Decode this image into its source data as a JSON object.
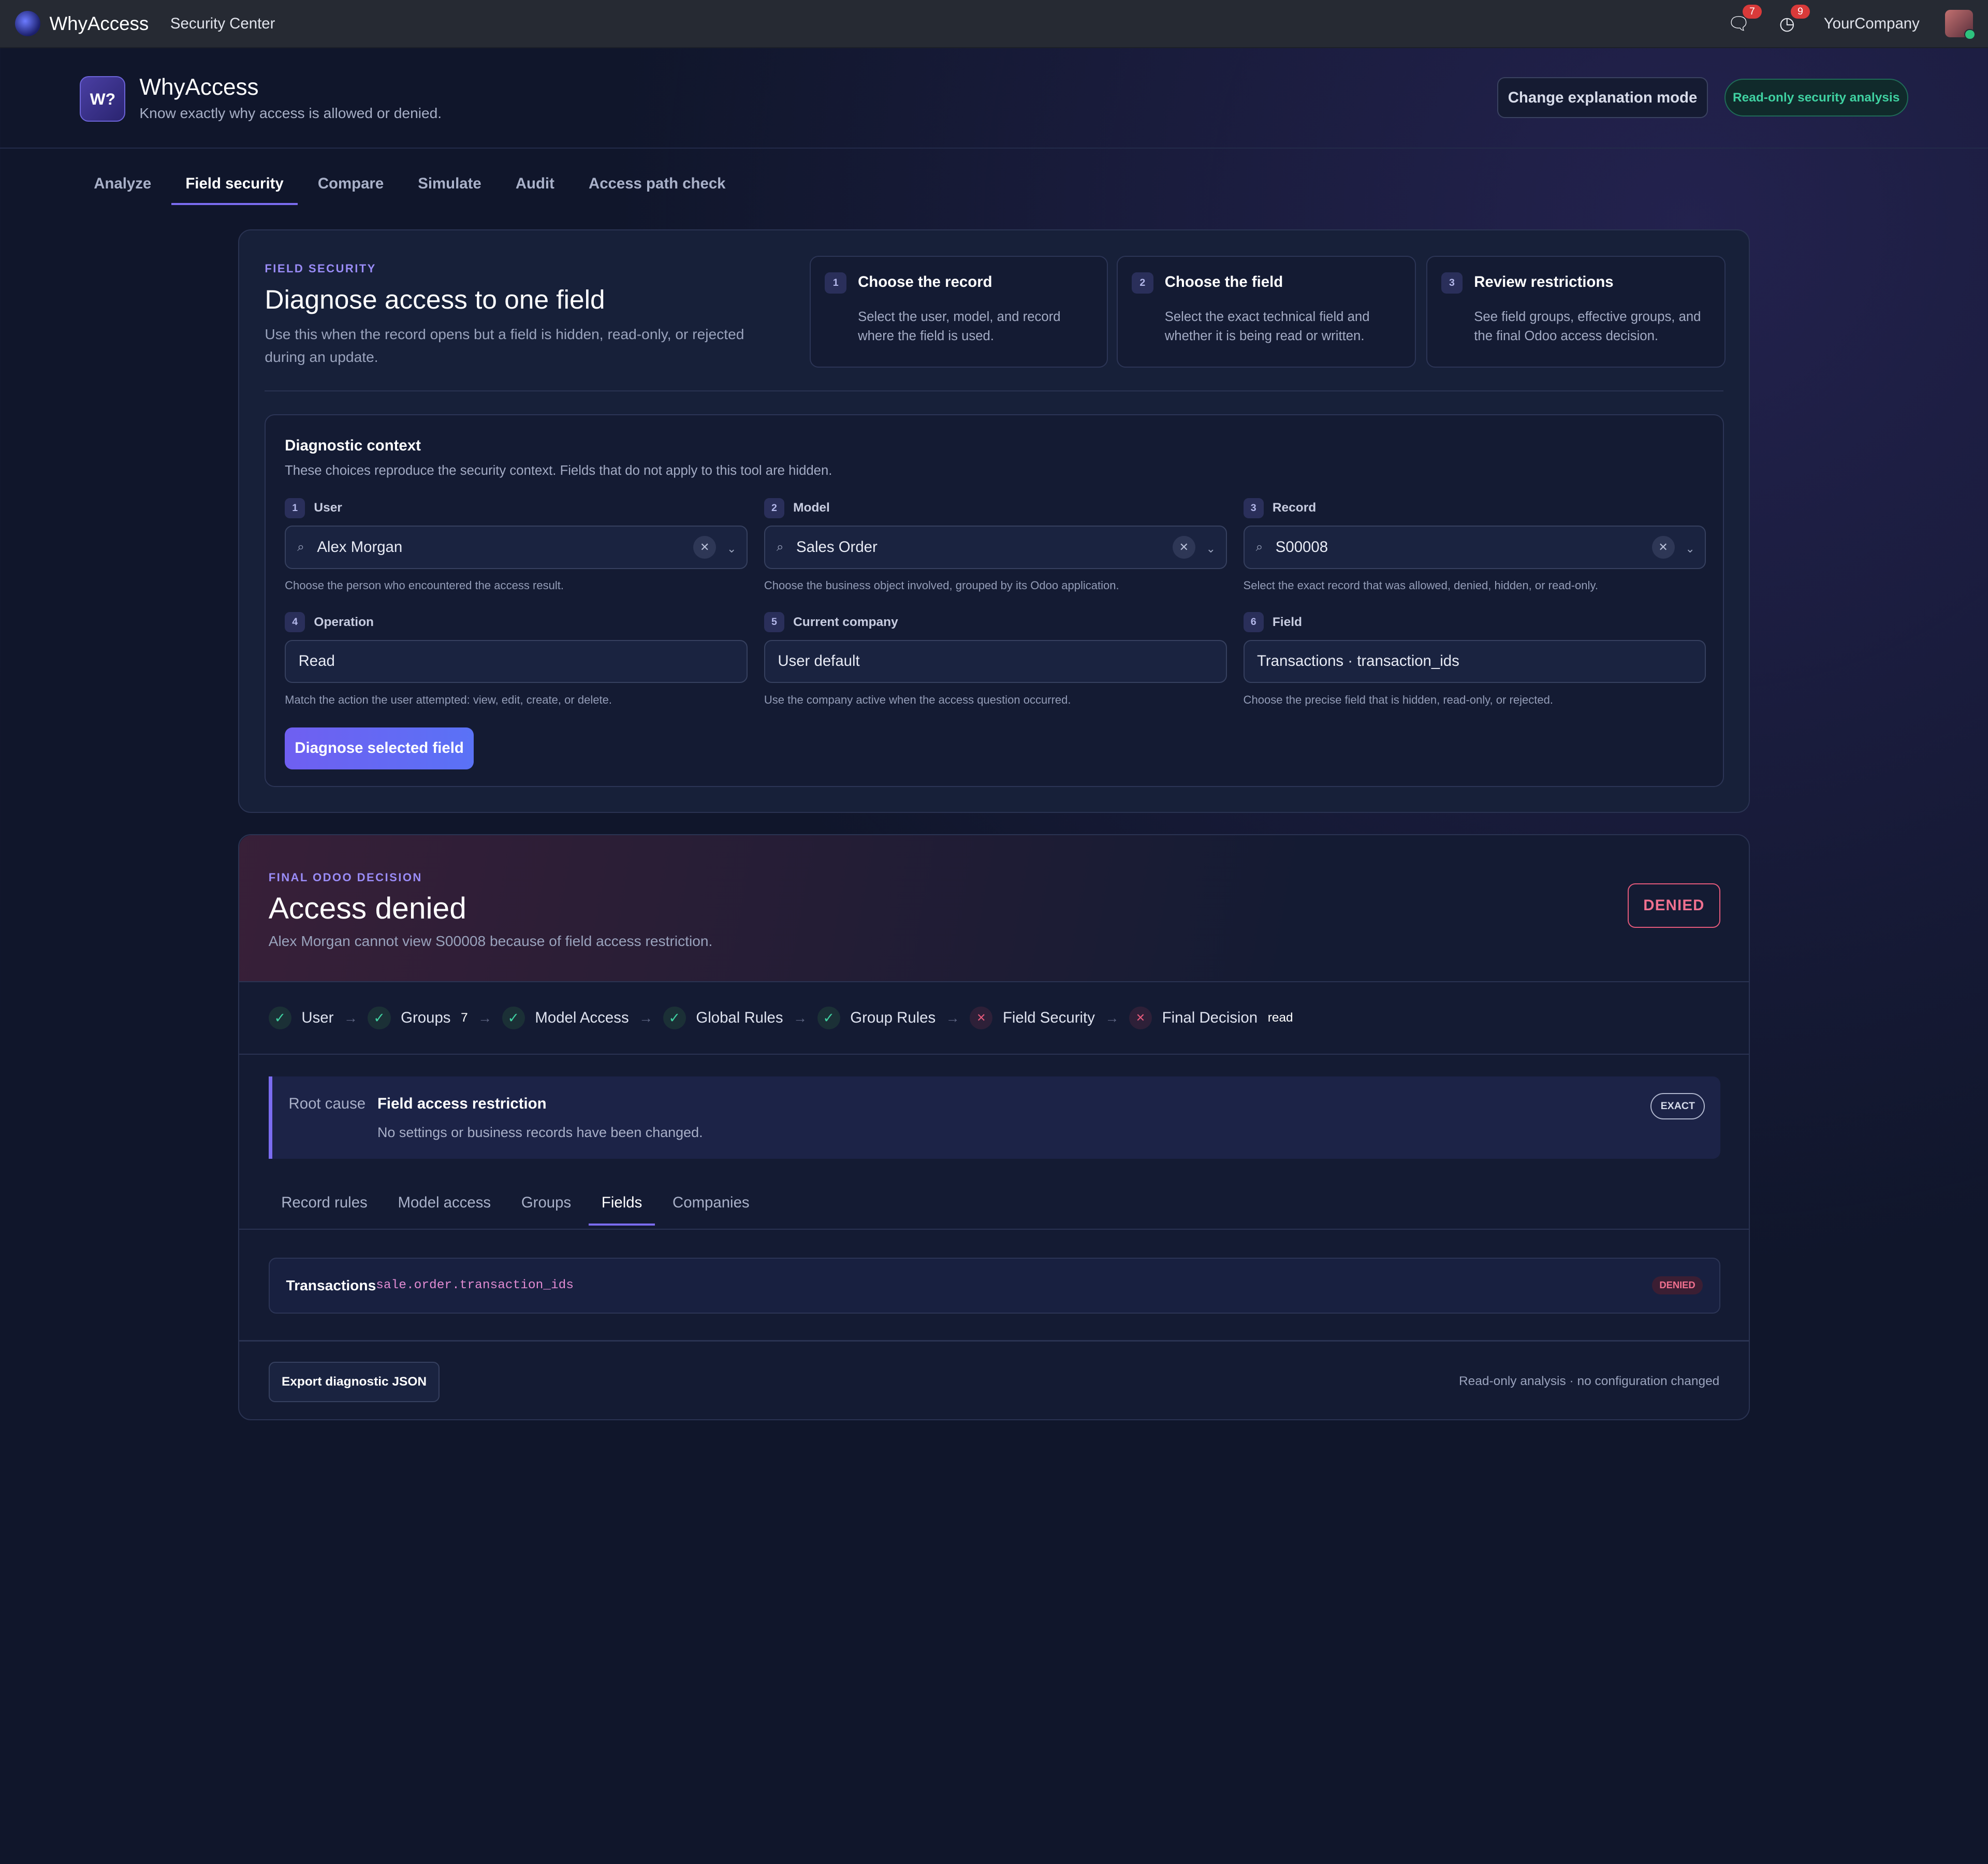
{
  "topbar": {
    "brand": "WhyAccess",
    "menu": "Security Center",
    "chat_badge": "7",
    "activity_badge": "9",
    "company": "YourCompany"
  },
  "header": {
    "logo_text": "W?",
    "title": "WhyAccess",
    "subtitle": "Know exactly why access is allowed or denied.",
    "mode_button": "Change explanation mode",
    "readonly_badge": "Read-only security analysis"
  },
  "tabs": [
    "Analyze",
    "Field security",
    "Compare",
    "Simulate",
    "Audit",
    "Access path check"
  ],
  "active_tab": "Field security",
  "field_security": {
    "eyebrow": "FIELD SECURITY",
    "title": "Diagnose access to one field",
    "description": "Use this when the record opens but a field is hidden, read-only, or rejected during an update.",
    "steps": [
      {
        "num": "1",
        "title": "Choose the record",
        "desc": "Select the user, model, and record where the field is used."
      },
      {
        "num": "2",
        "title": "Choose the field",
        "desc": "Select the exact technical field and whether it is being read or written."
      },
      {
        "num": "3",
        "title": "Review restrictions",
        "desc": "See field groups, effective groups, and the final Odoo access decision."
      }
    ]
  },
  "context": {
    "title": "Diagnostic context",
    "subtitle": "These choices reproduce the security context. Fields that do not apply to this tool are hidden.",
    "fields": [
      {
        "num": "1",
        "label": "User",
        "value": "Alex Morgan",
        "help": "Choose the person who encountered the access result."
      },
      {
        "num": "2",
        "label": "Model",
        "value": "Sales Order",
        "help": "Choose the business object involved, grouped by its Odoo application."
      },
      {
        "num": "3",
        "label": "Record",
        "value": "S00008",
        "help": "Select the exact record that was allowed, denied, hidden, or read-only."
      },
      {
        "num": "4",
        "label": "Operation",
        "value": "Read",
        "help": "Match the action the user attempted: view, edit, create, or delete."
      },
      {
        "num": "5",
        "label": "Current company",
        "value": "User default",
        "help": "Use the company active when the access question occurred."
      },
      {
        "num": "6",
        "label": "Field",
        "value": "Transactions · transaction_ids",
        "help": "Choose the precise field that is hidden, read-only, or rejected."
      }
    ],
    "diagnose_button": "Diagnose selected field"
  },
  "decision": {
    "eyebrow": "FINAL ODOO DECISION",
    "title": "Access denied",
    "summary": "Alex Morgan cannot view S00008 because of field access restriction.",
    "badge": "DENIED",
    "chain": [
      {
        "label": "User",
        "status": "ok"
      },
      {
        "label": "Groups",
        "status": "ok",
        "extra": "7"
      },
      {
        "label": "Model Access",
        "status": "ok"
      },
      {
        "label": "Global Rules",
        "status": "ok"
      },
      {
        "label": "Group Rules",
        "status": "ok"
      },
      {
        "label": "Field Security",
        "status": "denied"
      },
      {
        "label": "Final Decision",
        "status": "denied",
        "extra": "read"
      }
    ],
    "root_cause": {
      "label": "Root cause",
      "title": "Field access restriction",
      "note": "No settings or business records have been changed.",
      "badge": "EXACT"
    },
    "detail_tabs": [
      "Record rules",
      "Model access",
      "Groups",
      "Fields",
      "Companies"
    ],
    "active_detail_tab": "Fields",
    "field_row": {
      "name": "Transactions",
      "technical": "sale.order.transaction_ids",
      "status": "DENIED"
    },
    "export_button": "Export diagnostic JSON",
    "footnote": "Read-only analysis · no configuration changed"
  },
  "colors": {
    "accent": "#7b6cf0",
    "denied": "#e2597a",
    "ok": "#3fd1a1",
    "background": "#10162b"
  }
}
